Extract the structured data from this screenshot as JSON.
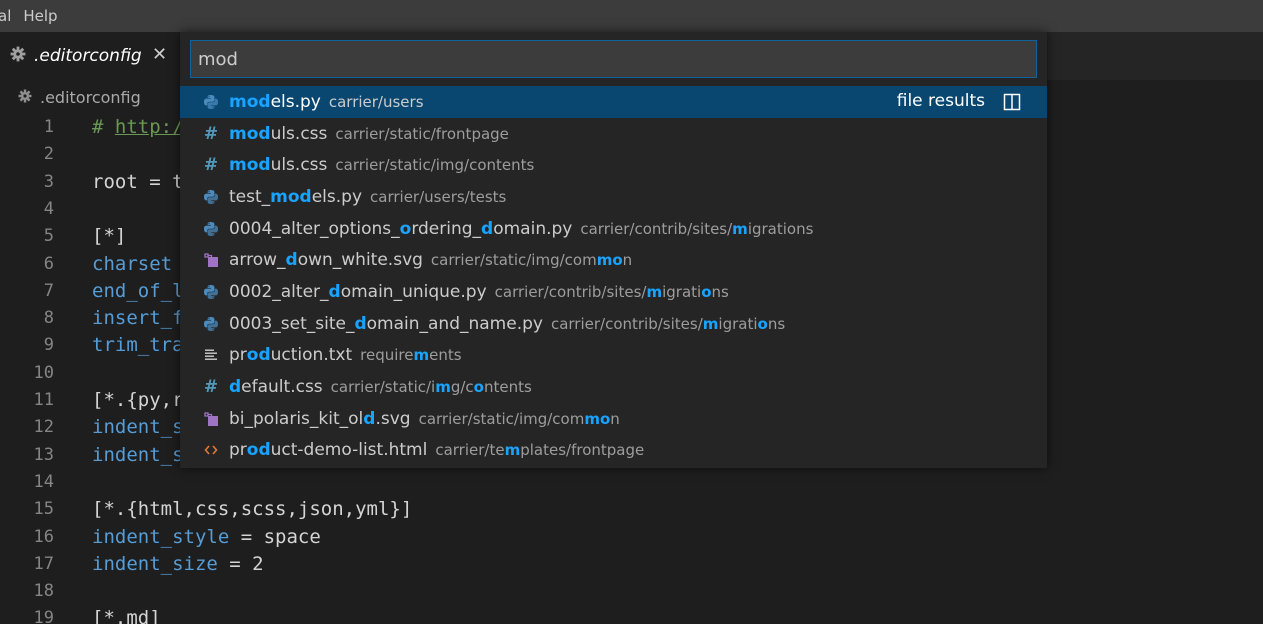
{
  "menu": [
    "al",
    "Help"
  ],
  "tab": {
    "label": ".editorconfig",
    "close": "✕"
  },
  "breadcrumb": ".editorconfig",
  "editor_lines": [
    {
      "n": "1",
      "segments": [
        {
          "t": "# ",
          "c": "comment"
        },
        {
          "t": "http:/",
          "c": "comment link"
        }
      ]
    },
    {
      "n": "2",
      "segments": []
    },
    {
      "n": "3",
      "segments": [
        {
          "t": "root = t",
          "c": ""
        }
      ]
    },
    {
      "n": "4",
      "segments": []
    },
    {
      "n": "5",
      "segments": [
        {
          "t": "[*]",
          "c": ""
        }
      ]
    },
    {
      "n": "6",
      "segments": [
        {
          "t": "charset",
          "c": "key"
        }
      ]
    },
    {
      "n": "7",
      "segments": [
        {
          "t": "end_of_l",
          "c": "key"
        }
      ]
    },
    {
      "n": "8",
      "segments": [
        {
          "t": "insert_f",
          "c": "key"
        }
      ]
    },
    {
      "n": "9",
      "segments": [
        {
          "t": "trim_tra",
          "c": "key"
        }
      ]
    },
    {
      "n": "10",
      "segments": []
    },
    {
      "n": "11",
      "segments": [
        {
          "t": "[*.{py,r",
          "c": ""
        }
      ]
    },
    {
      "n": "12",
      "segments": [
        {
          "t": "indent_s",
          "c": "key"
        }
      ]
    },
    {
      "n": "13",
      "segments": [
        {
          "t": "indent_s",
          "c": "key"
        }
      ]
    },
    {
      "n": "14",
      "segments": []
    },
    {
      "n": "15",
      "segments": [
        {
          "t": "[*.{html,css,scss,json,yml}]",
          "c": ""
        }
      ]
    },
    {
      "n": "16",
      "segments": [
        {
          "t": "indent_style",
          "c": "key"
        },
        {
          "t": " = space",
          "c": ""
        }
      ]
    },
    {
      "n": "17",
      "segments": [
        {
          "t": "indent_size",
          "c": "key"
        },
        {
          "t": " = 2",
          "c": ""
        }
      ]
    },
    {
      "n": "18",
      "segments": []
    },
    {
      "n": "19",
      "segments": [
        {
          "t": "[*.md]",
          "c": ""
        }
      ]
    }
  ],
  "quick_open": {
    "value": "mod",
    "meta_label": "file results",
    "results": [
      {
        "icon": "python-file-icon",
        "name": [
          {
            "t": "mod",
            "h": true
          },
          {
            "t": "els.py",
            "h": false
          }
        ],
        "path": [
          {
            "t": "carrier/users",
            "h": false
          }
        ]
      },
      {
        "icon": "css-file-icon",
        "name": [
          {
            "t": "mod",
            "h": true
          },
          {
            "t": "uls.css",
            "h": false
          }
        ],
        "path": [
          {
            "t": "carrier/static/frontpage",
            "h": false
          }
        ]
      },
      {
        "icon": "css-file-icon",
        "name": [
          {
            "t": "mod",
            "h": true
          },
          {
            "t": "uls.css",
            "h": false
          }
        ],
        "path": [
          {
            "t": "carrier/static/img/contents",
            "h": false
          }
        ]
      },
      {
        "icon": "python-file-icon",
        "name": [
          {
            "t": "test_",
            "h": false
          },
          {
            "t": "mod",
            "h": true
          },
          {
            "t": "els.py",
            "h": false
          }
        ],
        "path": [
          {
            "t": "carrier/users/tests",
            "h": false
          }
        ]
      },
      {
        "icon": "python-file-icon",
        "name": [
          {
            "t": "0004_alter_options_",
            "h": false
          },
          {
            "t": "o",
            "h": true
          },
          {
            "t": "rdering_",
            "h": false
          },
          {
            "t": "d",
            "h": true
          },
          {
            "t": "omain.py",
            "h": false
          }
        ],
        "path": [
          {
            "t": "carrier/contrib/sites/",
            "h": false
          },
          {
            "t": "m",
            "h": true
          },
          {
            "t": "igrations",
            "h": false
          }
        ]
      },
      {
        "icon": "svg-file-icon",
        "name": [
          {
            "t": "arrow_",
            "h": false
          },
          {
            "t": "d",
            "h": true
          },
          {
            "t": "own_white.svg",
            "h": false
          }
        ],
        "path": [
          {
            "t": "carrier/static/img/com",
            "h": false
          },
          {
            "t": "mo",
            "h": true
          },
          {
            "t": "n",
            "h": false
          }
        ]
      },
      {
        "icon": "python-file-icon",
        "name": [
          {
            "t": "0002_alter_",
            "h": false
          },
          {
            "t": "d",
            "h": true
          },
          {
            "t": "omain_unique.py",
            "h": false
          }
        ],
        "path": [
          {
            "t": "carrier/contrib/sites/",
            "h": false
          },
          {
            "t": "m",
            "h": true
          },
          {
            "t": "igrati",
            "h": false
          },
          {
            "t": "o",
            "h": true
          },
          {
            "t": "ns",
            "h": false
          }
        ]
      },
      {
        "icon": "python-file-icon",
        "name": [
          {
            "t": "0003_set_site_",
            "h": false
          },
          {
            "t": "d",
            "h": true
          },
          {
            "t": "omain_and_name.py",
            "h": false
          }
        ],
        "path": [
          {
            "t": "carrier/contrib/sites/",
            "h": false
          },
          {
            "t": "m",
            "h": true
          },
          {
            "t": "igrati",
            "h": false
          },
          {
            "t": "o",
            "h": true
          },
          {
            "t": "ns",
            "h": false
          }
        ]
      },
      {
        "icon": "text-file-icon",
        "name": [
          {
            "t": "pr",
            "h": false
          },
          {
            "t": "od",
            "h": true
          },
          {
            "t": "uction.txt",
            "h": false
          }
        ],
        "path": [
          {
            "t": "require",
            "h": false
          },
          {
            "t": "m",
            "h": true
          },
          {
            "t": "ents",
            "h": false
          }
        ]
      },
      {
        "icon": "css-file-icon",
        "name": [
          {
            "t": "d",
            "h": true
          },
          {
            "t": "efault.css",
            "h": false
          }
        ],
        "path": [
          {
            "t": "carrier/static/i",
            "h": false
          },
          {
            "t": "m",
            "h": true
          },
          {
            "t": "g/c",
            "h": false
          },
          {
            "t": "o",
            "h": true
          },
          {
            "t": "ntents",
            "h": false
          }
        ]
      },
      {
        "icon": "svg-file-icon",
        "name": [
          {
            "t": "bi_polaris_kit_ol",
            "h": false
          },
          {
            "t": "d",
            "h": true
          },
          {
            "t": ".svg",
            "h": false
          }
        ],
        "path": [
          {
            "t": "carrier/static/img/com",
            "h": false
          },
          {
            "t": "mo",
            "h": true
          },
          {
            "t": "n",
            "h": false
          }
        ]
      },
      {
        "icon": "html-file-icon",
        "name": [
          {
            "t": "pr",
            "h": false
          },
          {
            "t": "od",
            "h": true
          },
          {
            "t": "uct-demo-list.html",
            "h": false
          }
        ],
        "path": [
          {
            "t": "carrier/te",
            "h": false
          },
          {
            "t": "m",
            "h": true
          },
          {
            "t": "plates/frontpage",
            "h": false
          }
        ]
      }
    ]
  },
  "colors": {
    "menubar": "#3c3c3c",
    "editor_bg": "#1e1e1e",
    "quickopen_bg": "#252526",
    "selection": "#094771",
    "highlight": "#18a3ff",
    "python_icon": "#4b8bbe",
    "css_icon": "#519aba",
    "svg_icon": "#a074c4",
    "html_icon": "#e37933"
  }
}
